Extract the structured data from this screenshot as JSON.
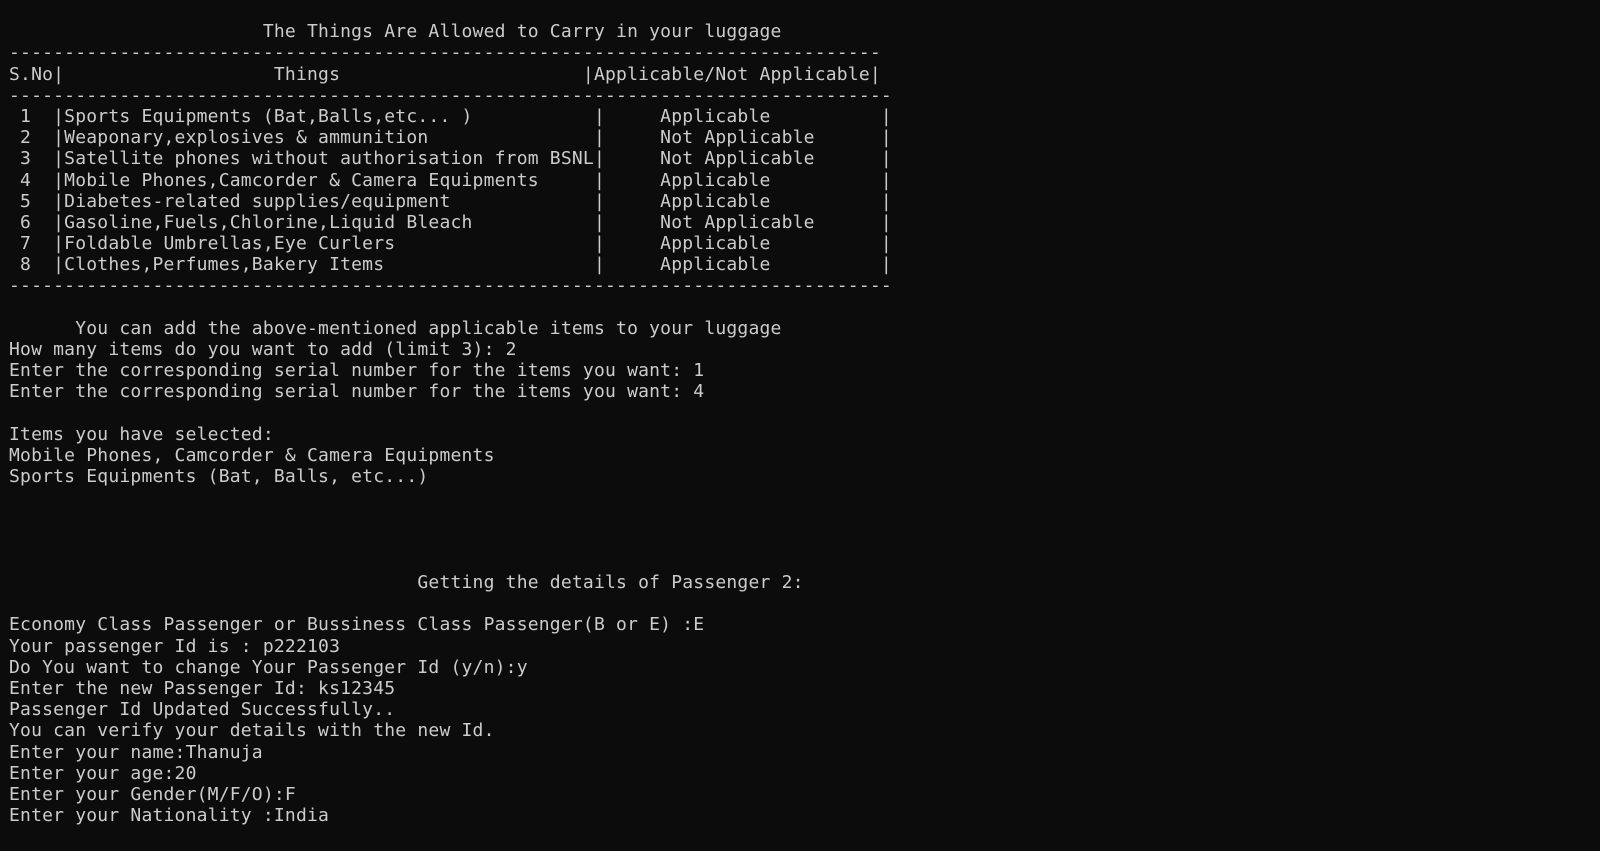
{
  "terminal": {
    "lines": [
      "",
      "                       The Things Are Allowed to Carry in your luggage",
      "-------------------------------------------------------------------------------",
      "S.No|                   Things                      |Applicable/Not Applicable|",
      "--------------------------------------------------------------------------------",
      " 1  |Sports Equipments (Bat,Balls,etc... )           |     Applicable          |",
      " 2  |Weaponary,explosives & ammunition               |     Not Applicable      |",
      " 3  |Satellite phones without authorisation from BSNL|     Not Applicable      |",
      " 4  |Mobile Phones,Camcorder & Camera Equipments     |     Applicable          |",
      " 5  |Diabetes-related supplies/equipment             |     Applicable          |",
      " 6  |Gasoline,Fuels,Chlorine,Liquid Bleach           |     Not Applicable      |",
      " 7  |Foldable Umbrellas,Eye Curlers                  |     Applicable          |",
      " 8  |Clothes,Perfumes,Bakery Items                   |     Applicable          |",
      "--------------------------------------------------------------------------------",
      "",
      "      You can add the above-mentioned applicable items to your luggage",
      "How many items do you want to add (limit 3): 2",
      "Enter the corresponding serial number for the items you want: 1",
      "Enter the corresponding serial number for the items you want: 4",
      "",
      "Items you have selected:",
      "Mobile Phones, Camcorder & Camera Equipments",
      "Sports Equipments (Bat, Balls, etc...)",
      "",
      "",
      "",
      "",
      "                                     Getting the details of Passenger 2:",
      "",
      "Economy Class Passenger or Bussiness Class Passenger(B or E) :E",
      "Your passenger Id is : p222103",
      "Do You want to change Your Passenger Id (y/n):y",
      "Enter the new Passenger Id: ks12345",
      "Passenger Id Updated Successfully..",
      "You can verify your details with the new Id.",
      "Enter your name:Thanuja",
      "Enter your age:20",
      "Enter your Gender(M/F/O):F",
      "Enter your Nationality :India"
    ]
  },
  "colors": {
    "background": "#0c0c0c",
    "foreground": "#cccccc"
  }
}
